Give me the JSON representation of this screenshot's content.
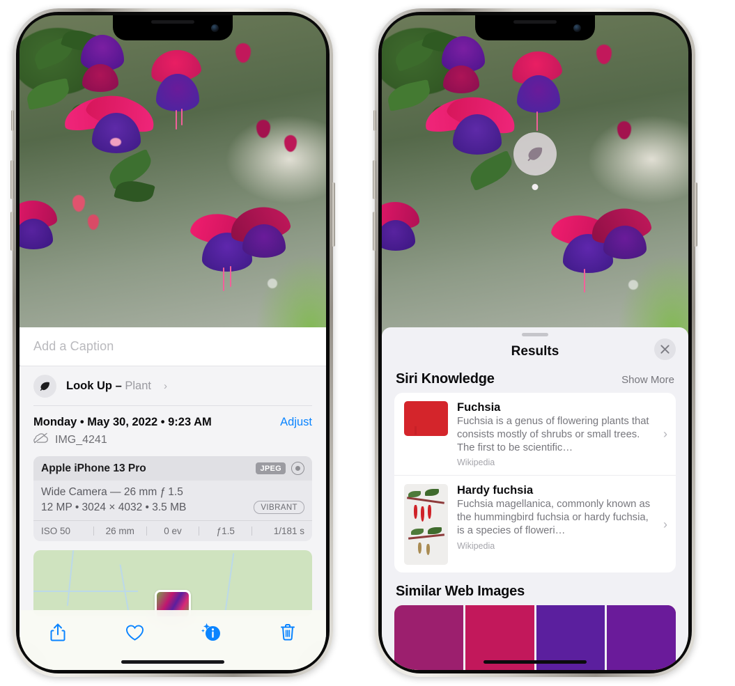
{
  "left_phone": {
    "caption": {
      "placeholder": "Add a Caption",
      "value": ""
    },
    "lookup": {
      "label": "Look Up",
      "dash": "–",
      "subject": "Plant",
      "chevron": "›",
      "icon": "leaf-icon"
    },
    "meta": {
      "date": "Monday • May 30, 2022 • 9:23 AM",
      "adjust_label": "Adjust",
      "filename": "IMG_4241",
      "cloud_icon": "cloud-slash-icon"
    },
    "exif": {
      "model": "Apple iPhone 13 Pro",
      "format_badge": "JPEG",
      "raw_icon": "raw-circle-icon",
      "lens_line": "Wide Camera — 26 mm ƒ 1.5",
      "size_line": "12 MP • 3024 × 4032 • 3.5 MB",
      "style_badge": "VIBRANT",
      "stats": [
        "ISO 50",
        "26 mm",
        "0 ev",
        "ƒ1.5",
        "1/181 s"
      ]
    },
    "toolbar": [
      {
        "name": "share-button",
        "icon": "share-icon"
      },
      {
        "name": "favorite-button",
        "icon": "heart-icon"
      },
      {
        "name": "info-button",
        "icon": "info-sparkle-icon"
      },
      {
        "name": "delete-button",
        "icon": "trash-icon"
      }
    ]
  },
  "right_phone": {
    "lens_badge_icon": "leaf-icon",
    "sheet": {
      "title": "Results",
      "close_icon": "close-icon"
    },
    "siri_knowledge": {
      "heading": "Siri Knowledge",
      "show_more": "Show More",
      "cards": [
        {
          "title": "Fuchsia",
          "description": "Fuchsia is a genus of flowering plants that consists mostly of shrubs or small trees. The first to be scientific…",
          "source": "Wikipedia",
          "chevron": "›"
        },
        {
          "title": "Hardy fuchsia",
          "description": "Fuchsia magellanica, commonly known as the hummingbird fuchsia or hardy fuchsia, is a species of floweri…",
          "source": "Wikipedia",
          "chevron": "›"
        }
      ]
    },
    "similar_web_images": {
      "heading": "Similar Web Images",
      "count": 4
    }
  },
  "colors": {
    "accent_blue": "#0A84FF",
    "sheet_gray": "#F1F1F5",
    "card_white": "#FFFFFF",
    "secondary_text": "#77777D",
    "primary_text": "#0B0B0D"
  }
}
